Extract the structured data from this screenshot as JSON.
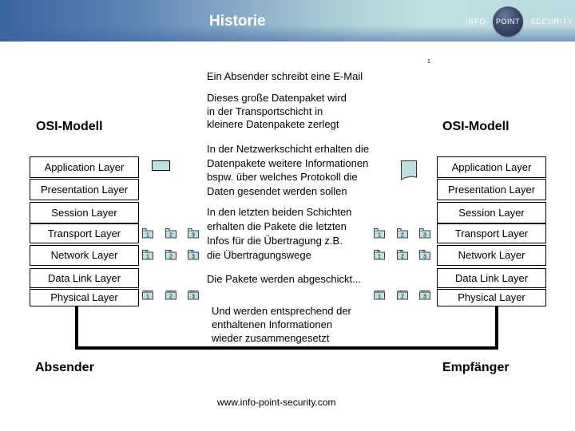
{
  "header": {
    "title": "Historie",
    "brand": {
      "info": "INFO-",
      "point": "POINT",
      "security": "- SECURITY"
    }
  },
  "page_number": "1",
  "captions": {
    "step1": [
      "Ein Absender schreibt eine E-Mail"
    ],
    "step2": [
      "Dieses große Datenpaket wird",
      "in der Transportschicht in",
      "kleinere Datenpakete zerlegt"
    ],
    "step3": [
      "In der Netzwerkschicht erhalten die",
      "Datenpakete weitere Informationen",
      "bspw. über welches Protokoll die",
      "Daten gesendet werden sollen"
    ],
    "step4": [
      "In den letzten beiden Schichten",
      "erhalten die Pakete die letzten",
      "Infos für die Übertragung z.B.",
      "die Übertragungswege"
    ],
    "step5": [
      "Die Pakete werden abgeschickt..."
    ],
    "step6": [
      "Und werden entsprechend der",
      "enthaltenen Informationen",
      "wieder zusammengesetzt"
    ]
  },
  "sender": {
    "model_title": "OSI-Modell",
    "label": "Absender",
    "layers": [
      "Application Layer",
      "Presentation Layer",
      "Session Layer",
      "Transport Layer",
      "Network Layer",
      "Data Link Layer",
      "Physical Layer"
    ]
  },
  "receiver": {
    "model_title": "OSI-Modell",
    "label": "Empfänger",
    "layers": [
      "Application Layer",
      "Presentation Layer",
      "Session Layer",
      "Transport Layer",
      "Network Layer",
      "Data Link Layer",
      "Physical Layer"
    ]
  },
  "packets": {
    "labels": [
      "1",
      "2",
      "3"
    ],
    "fill": "#bfe0e3",
    "stroke": "#1a1a1a",
    "sender_rows": [
      "transport",
      "network",
      "physical"
    ],
    "receiver_rows": [
      "transport",
      "network",
      "physical"
    ]
  },
  "footer": {
    "url": "www.info-point-security.com"
  },
  "icons": {
    "email_message": "message-block-icon",
    "received_document": "document-icon",
    "packet": "packet-folder-icon"
  }
}
